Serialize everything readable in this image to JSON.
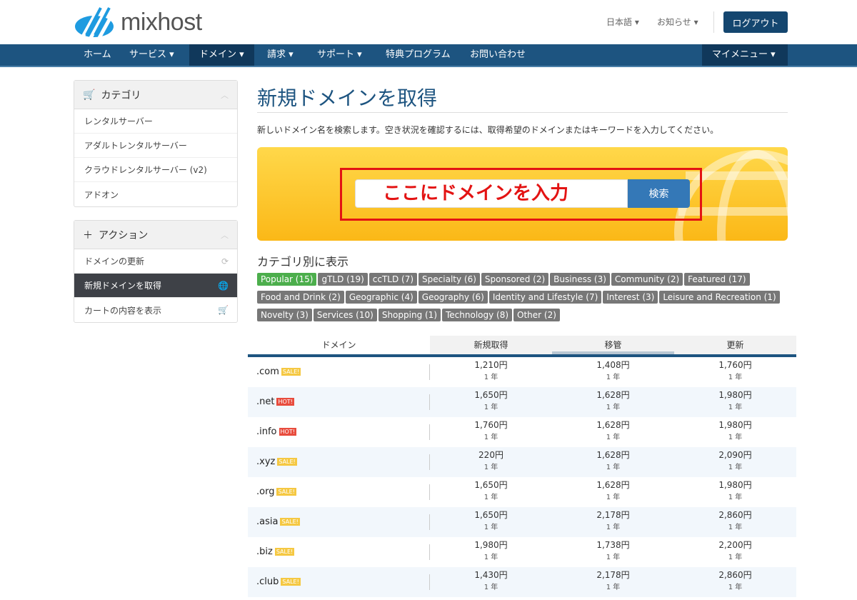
{
  "header": {
    "logo_text": "mixhost",
    "language": "日本語",
    "notices": "お知らせ",
    "logout": "ログアウト"
  },
  "nav": {
    "items": [
      {
        "label": "ホーム"
      },
      {
        "label": "サービス ▾"
      },
      {
        "label": "ドメイン ▾"
      },
      {
        "label": "請求 ▾"
      },
      {
        "label": "サポート ▾"
      },
      {
        "label": "特典プログラム"
      },
      {
        "label": "お問い合わせ"
      }
    ],
    "my_menu": "マイメニュー ▾"
  },
  "sidebar": {
    "categories": {
      "title": "カテゴリ",
      "items": [
        "レンタルサーバー",
        "アダルトレンタルサーバー",
        "クラウドレンタルサーバー (v2)",
        "アドオン"
      ]
    },
    "actions": {
      "title": "アクション",
      "items": [
        {
          "label": "ドメインの更新",
          "icon": "refresh-icon"
        },
        {
          "label": "新規ドメインを取得",
          "icon": "globe-icon"
        },
        {
          "label": "カートの内容を表示",
          "icon": "cart-icon"
        }
      ]
    }
  },
  "main": {
    "title": "新規ドメインを取得",
    "description": "新しいドメイン名を検索します。空き状況を確認するには、取得希望のドメインまたはキーワードを入力してください。",
    "search": {
      "value": "ここにドメインを入力",
      "button": "検索"
    },
    "category_heading": "カテゴリ別に表示",
    "tags": [
      "Popular (15)",
      "gTLD (19)",
      "ccTLD (7)",
      "Specialty (6)",
      "Sponsored (2)",
      "Business (3)",
      "Community (2)",
      "Featured (17)",
      "Food and Drink (2)",
      "Geographic (4)",
      "Geography (6)",
      "Identity and Lifestyle (7)",
      "Interest (3)",
      "Leisure and Recreation (1)",
      "Novelty (3)",
      "Services (10)",
      "Shopping (1)",
      "Technology (8)",
      "Other (2)"
    ],
    "table": {
      "headers": [
        "ドメイン",
        "新規取得",
        "移管",
        "更新"
      ],
      "period": "1 年",
      "rows": [
        {
          "domain": ".com",
          "badge": "SALE!",
          "new": "1,210円",
          "transfer": "1,408円",
          "renew": "1,760円"
        },
        {
          "domain": ".net",
          "badge": "HOT!",
          "new": "1,650円",
          "transfer": "1,628円",
          "renew": "1,980円"
        },
        {
          "domain": ".info",
          "badge": "HOT!",
          "new": "1,760円",
          "transfer": "1,628円",
          "renew": "1,980円"
        },
        {
          "domain": ".xyz",
          "badge": "SALE!",
          "new": "220円",
          "transfer": "1,628円",
          "renew": "2,090円"
        },
        {
          "domain": ".org",
          "badge": "SALE!",
          "new": "1,650円",
          "transfer": "1,628円",
          "renew": "1,980円"
        },
        {
          "domain": ".asia",
          "badge": "SALE!",
          "new": "1,650円",
          "transfer": "2,178円",
          "renew": "2,860円"
        },
        {
          "domain": ".biz",
          "badge": "SALE!",
          "new": "1,980円",
          "transfer": "1,738円",
          "renew": "2,200円"
        },
        {
          "domain": ".club",
          "badge": "SALE!",
          "new": "1,430円",
          "transfer": "2,178円",
          "renew": "2,860円"
        }
      ]
    }
  },
  "colors": {
    "nav": "#1d5480",
    "sale": "#f5c842",
    "hot": "#e84c3d",
    "popular": "#4cae4c",
    "tag": "#777777"
  }
}
